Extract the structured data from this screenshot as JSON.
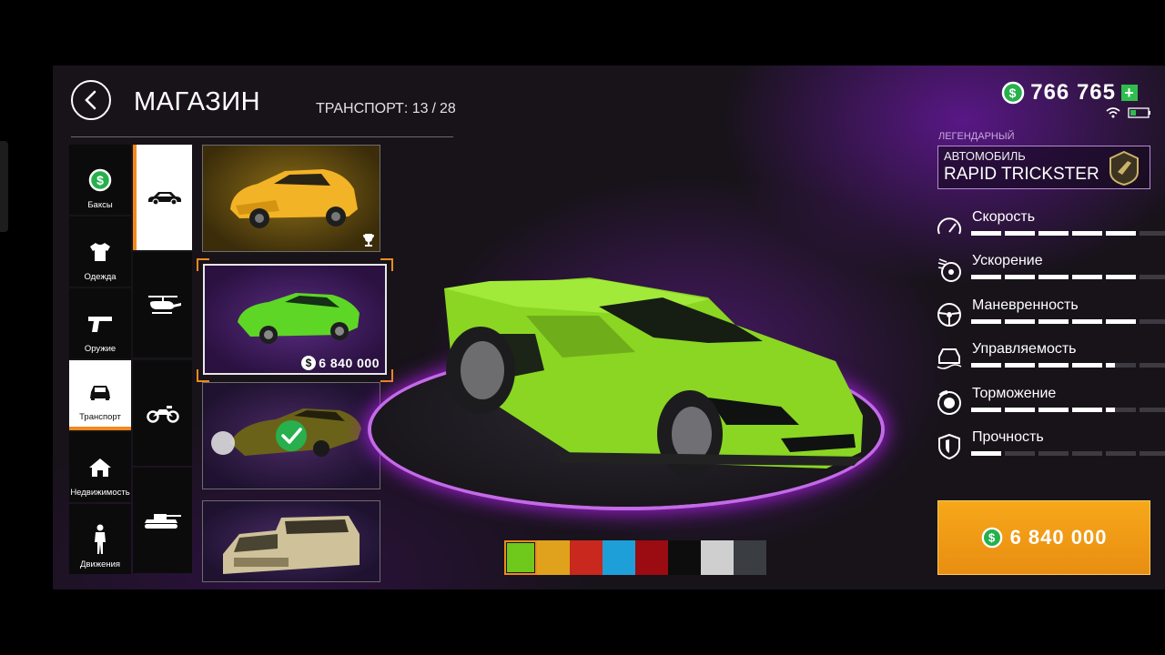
{
  "header": {
    "title": "МАГАЗИН",
    "counter_label": "ТРАНСПОРТ:",
    "counter_current": "13",
    "counter_sep": "/",
    "counter_total": "28"
  },
  "categories": [
    {
      "label": "Баксы",
      "icon": "dollar-coin-icon",
      "active": false
    },
    {
      "label": "Одежда",
      "icon": "tshirt-icon",
      "active": false
    },
    {
      "label": "Оружие",
      "icon": "pistol-icon",
      "active": false
    },
    {
      "label": "Транспорт",
      "icon": "car-icon",
      "active": true
    },
    {
      "label": "Недвижимость",
      "icon": "house-icon",
      "active": false
    },
    {
      "label": "Движения",
      "icon": "person-icon",
      "active": false
    }
  ],
  "subcategories": [
    {
      "icon": "car-icon",
      "active": true
    },
    {
      "icon": "helicopter-icon",
      "active": false
    },
    {
      "icon": "motorcycle-icon",
      "active": false
    },
    {
      "icon": "tank-icon",
      "active": false
    }
  ],
  "vehicles": [
    {
      "name": "yellow-suv",
      "icon": "trophy-icon",
      "price": ""
    },
    {
      "name": "green-supercar",
      "icon": "dollar-coin-icon",
      "price": "6 840 000",
      "selected": true
    },
    {
      "name": "olive-sportscar",
      "icon": "checkmark-icon",
      "price": "",
      "owned": true
    },
    {
      "name": "armored-truck",
      "icon": "",
      "price": ""
    }
  ],
  "wallet": {
    "balance": "766 765",
    "plus": "+"
  },
  "vehicle_info": {
    "rarity": "ЛЕГЕНДАРНЫЙ",
    "type": "АВТОМОБИЛЬ",
    "name": "RAPID TRICKSTER"
  },
  "stats": [
    {
      "label": "Скорость",
      "icon": "speedometer-icon",
      "level": 5,
      "max": 6
    },
    {
      "label": "Ускорение",
      "icon": "turbo-icon",
      "level": 5,
      "max": 6
    },
    {
      "label": "Маневренность",
      "icon": "steering-wheel-icon",
      "level": 5,
      "max": 6
    },
    {
      "label": "Управляемость",
      "icon": "car-handling-icon",
      "level": 4.3,
      "max": 6
    },
    {
      "label": "Торможение",
      "icon": "brake-disc-icon",
      "level": 4.3,
      "max": 6
    },
    {
      "label": "Прочность",
      "icon": "shield-icon",
      "level": 1,
      "max": 6
    }
  ],
  "colors": [
    "#6fc81c",
    "#e0a21c",
    "#c8281e",
    "#1f9fd8",
    "#9a0b12",
    "#0d0d0d",
    "#cfcfcf",
    "#3a3d42"
  ],
  "selected_color": "#6fc81c",
  "buy": {
    "price": "6 840 000"
  },
  "accent": "#f08a1c",
  "money_green": "#27b04d"
}
